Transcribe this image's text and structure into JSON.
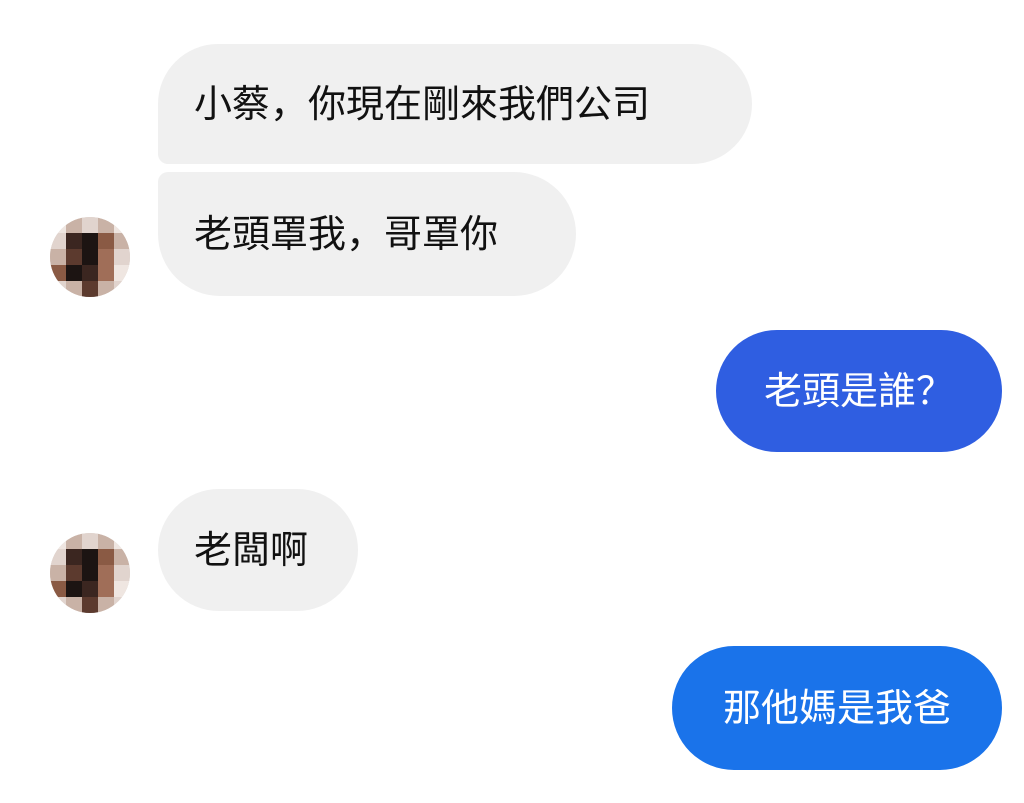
{
  "messages": [
    {
      "id": "msg1",
      "sender": "other",
      "text": "小蔡，你現在剛來我們公司"
    },
    {
      "id": "msg2",
      "sender": "other",
      "text": "老頭罩我，哥罩你"
    },
    {
      "id": "msg3",
      "sender": "me",
      "text": "老頭是誰？"
    },
    {
      "id": "msg4",
      "sender": "other",
      "text": "老闆啊"
    },
    {
      "id": "msg5",
      "sender": "me",
      "text": "那他媽是我爸"
    }
  ],
  "avatar": {
    "description_icon": "pixelated-avatar-icon",
    "palette": [
      "#efe6e1",
      "#c9b2a6",
      "#8a5a44",
      "#3b2620",
      "#1c1412",
      "#a06e58",
      "#e1d4ce",
      "#5c3a2e"
    ]
  },
  "colors": {
    "incoming_bubble": "#f0f0f0",
    "outgoing_bubble_1": "#2f5ee1",
    "outgoing_bubble_2": "#1a73ea",
    "background": "#ffffff"
  }
}
